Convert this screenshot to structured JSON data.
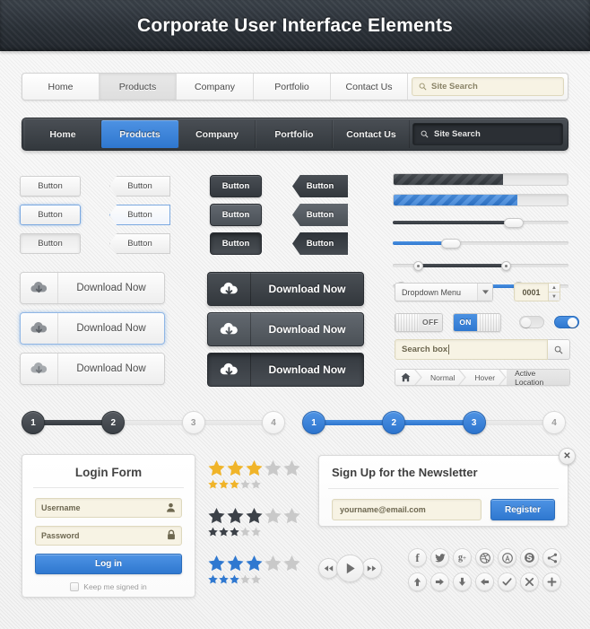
{
  "header": {
    "title": "Corporate User Interface Elements"
  },
  "nav_light": {
    "items": [
      {
        "label": "Home",
        "active": false
      },
      {
        "label": "Products",
        "active": true
      },
      {
        "label": "Company",
        "active": false
      },
      {
        "label": "Portfolio",
        "active": false
      },
      {
        "label": "Contact Us",
        "active": false
      }
    ],
    "search_placeholder": "Site Search",
    "search_icon": "search-icon"
  },
  "nav_dark": {
    "items": [
      {
        "label": "Home",
        "active": false
      },
      {
        "label": "Products",
        "active": true
      },
      {
        "label": "Company",
        "active": false
      },
      {
        "label": "Portfolio",
        "active": false
      },
      {
        "label": "Contact Us",
        "active": false
      }
    ],
    "search_placeholder": "Site Search",
    "search_icon": "search-icon"
  },
  "buttons": {
    "label": "Button",
    "light_states": [
      "normal",
      "focus",
      "pressed"
    ],
    "dark_states": [
      "normal",
      "hover",
      "pressed"
    ]
  },
  "download": {
    "label": "Download Now",
    "icon": "cloud-download-icon",
    "light_states": [
      "normal",
      "focus",
      "pressed"
    ],
    "dark_states": [
      "normal",
      "hover",
      "pressed"
    ]
  },
  "sliders": {
    "progress_dark_pct": 63,
    "progress_blue_pct": 71,
    "slider_dark_pct": 69,
    "slider_blue_pct": 33,
    "range_dark": {
      "from": 15,
      "to": 65
    },
    "range_blue": {
      "from": 5,
      "to": 72
    }
  },
  "controls": {
    "dropdown_value": "Dropdown Menu",
    "dropdown_caret_icon": "chevron-down-icon",
    "stepper_value": "0001",
    "switch_off_label": "OFF",
    "switch_on_label": "ON",
    "checkbox_unchecked": false,
    "checkbox_checked": true,
    "radio_unchecked": false,
    "radio_checked": true,
    "search_value": "Search box",
    "search_button_icon": "search-icon"
  },
  "breadcrumb": {
    "home_icon": "home-icon",
    "items": [
      {
        "label": "Normal",
        "state": "normal"
      },
      {
        "label": "Hover",
        "state": "hover"
      },
      {
        "label": "Active Location",
        "state": "active"
      }
    ]
  },
  "steps_dark": {
    "nodes": [
      "1",
      "2",
      "3",
      "4"
    ],
    "completed_through": 2,
    "color": "#3a3f45"
  },
  "steps_blue": {
    "nodes": [
      "1",
      "2",
      "3",
      "4"
    ],
    "completed_through": 3,
    "color": "#2d74cd"
  },
  "login": {
    "title": "Login Form",
    "username_placeholder": "Username",
    "username_icon": "user-icon",
    "password_placeholder": "Password",
    "password_icon": "lock-icon",
    "submit_label": "Log in",
    "remember_label": "Keep me signed in",
    "remember_checked": false
  },
  "ratings": [
    {
      "color": "#f0b429",
      "filled": 3,
      "total": 5
    },
    {
      "color": "#3c4148",
      "filled": 3,
      "total": 5
    },
    {
      "color": "#2f78d0",
      "filled": 3,
      "total": 5
    }
  ],
  "newsletter": {
    "title": "Sign Up for the Newsletter",
    "email_placeholder": "yourname@email.com",
    "register_label": "Register",
    "close_icon": "close-icon"
  },
  "media": {
    "prev_icon": "rewind-icon",
    "play_icon": "play-icon",
    "next_icon": "fast-forward-icon"
  },
  "social_icons": [
    {
      "name": "facebook-icon",
      "glyph": "f"
    },
    {
      "name": "twitter-icon",
      "glyph": "✒"
    },
    {
      "name": "google-plus-icon",
      "glyph": "g+"
    },
    {
      "name": "dribbble-icon",
      "glyph": "◎"
    },
    {
      "name": "android-icon",
      "glyph": "A"
    },
    {
      "name": "skype-icon",
      "glyph": "S"
    },
    {
      "name": "share-icon",
      "glyph": "≪"
    }
  ],
  "action_icons": [
    {
      "name": "arrow-up-icon",
      "glyph": "↑"
    },
    {
      "name": "arrow-right-icon",
      "glyph": "→"
    },
    {
      "name": "arrow-down-icon",
      "glyph": "↓"
    },
    {
      "name": "arrow-left-icon",
      "glyph": "←"
    },
    {
      "name": "check-icon",
      "glyph": "✓"
    },
    {
      "name": "close-x-icon",
      "glyph": "✕"
    },
    {
      "name": "plus-icon",
      "glyph": "+"
    }
  ],
  "colors": {
    "accent_blue": "#2f78d0",
    "dark": "#33383d",
    "field_cream": "#f7f3e4",
    "star_gold": "#f0b429"
  }
}
